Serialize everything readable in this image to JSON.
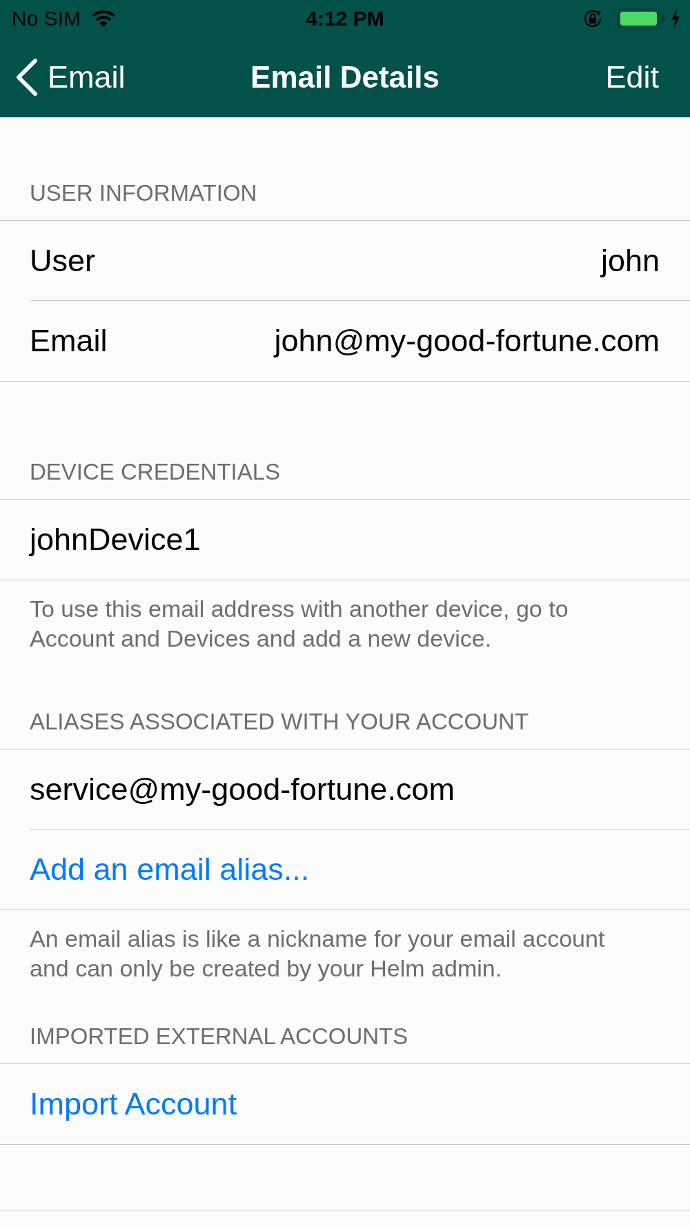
{
  "status_bar": {
    "carrier": "No SIM",
    "time": "4:12 PM"
  },
  "nav_bar": {
    "back_label": "Email",
    "title": "Email Details",
    "action": "Edit"
  },
  "sections": [
    {
      "header": "USER INFORMATION",
      "rows": [
        {
          "kind": "field",
          "label": "User",
          "value": "john"
        },
        {
          "kind": "field",
          "label": "Email",
          "value": "john@my-good-fortune.com"
        }
      ]
    },
    {
      "header": "DEVICE CREDENTIALS",
      "rows": [
        {
          "kind": "text",
          "label": "johnDevice1"
        }
      ],
      "footer": "To use this email address with another device, go to Account and Devices and add a new device."
    },
    {
      "header": "ALIASES ASSOCIATED WITH YOUR ACCOUNT",
      "rows": [
        {
          "kind": "text",
          "label": "service@my-good-fortune.com"
        },
        {
          "kind": "action",
          "label": "Add an email alias..."
        }
      ],
      "footer": "An email alias is like a nickname for your email account and can only be created by your Helm admin."
    },
    {
      "header": "IMPORTED EXTERNAL ACCOUNTS",
      "rows": [
        {
          "kind": "action",
          "label": "Import Account"
        }
      ]
    }
  ]
}
